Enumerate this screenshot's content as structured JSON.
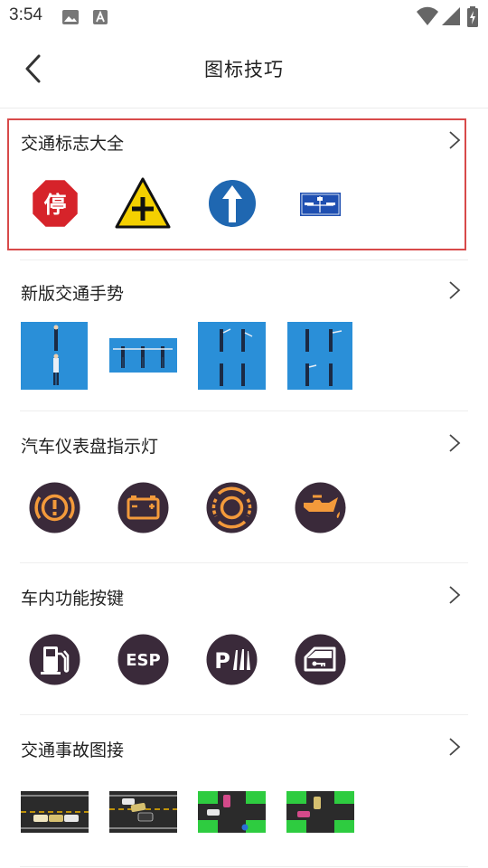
{
  "status_bar": {
    "time": "3:54",
    "left_icons": [
      "image-icon",
      "a-box-icon"
    ],
    "right_icons": [
      "wifi-icon",
      "signal-icon",
      "battery-charging-icon"
    ]
  },
  "header": {
    "title": "图标技巧",
    "back_icon": "chevron-left-icon"
  },
  "sections": [
    {
      "title": "交通标志大全",
      "items": [
        "stop-sign",
        "crossroad-warning-sign",
        "straight-ahead-sign",
        "direction-guide-sign"
      ]
    },
    {
      "title": "新版交通手势",
      "items": [
        "gesture-stop",
        "gesture-straight",
        "gesture-left-turn",
        "gesture-right-turn"
      ]
    },
    {
      "title": "汽车仪表盘指示灯",
      "items": [
        "brake-warning-icon",
        "battery-warning-icon",
        "brake-pad-icon",
        "oil-pressure-icon"
      ]
    },
    {
      "title": "车内功能按键",
      "items": [
        "fuel-icon",
        "esp-icon",
        "parking-sensor-icon",
        "door-lock-icon"
      ]
    },
    {
      "title": "交通事故图接",
      "items": [
        "accident-rear-end",
        "accident-lane-change",
        "accident-intersection-1",
        "accident-intersection-2"
      ]
    }
  ],
  "labels": {
    "stop_sign_text": "停",
    "esp_text": "ESP",
    "parking_text": "P"
  },
  "colors": {
    "highlight_border": "#d84a4a",
    "dash_icon_bg": "#3a2a3a",
    "dash_icon_orange": "#f39a3b",
    "gesture_bg": "#2a8fd8",
    "sign_red": "#d6232a",
    "sign_yellow": "#f4d000",
    "sign_blue": "#1f67b1"
  }
}
